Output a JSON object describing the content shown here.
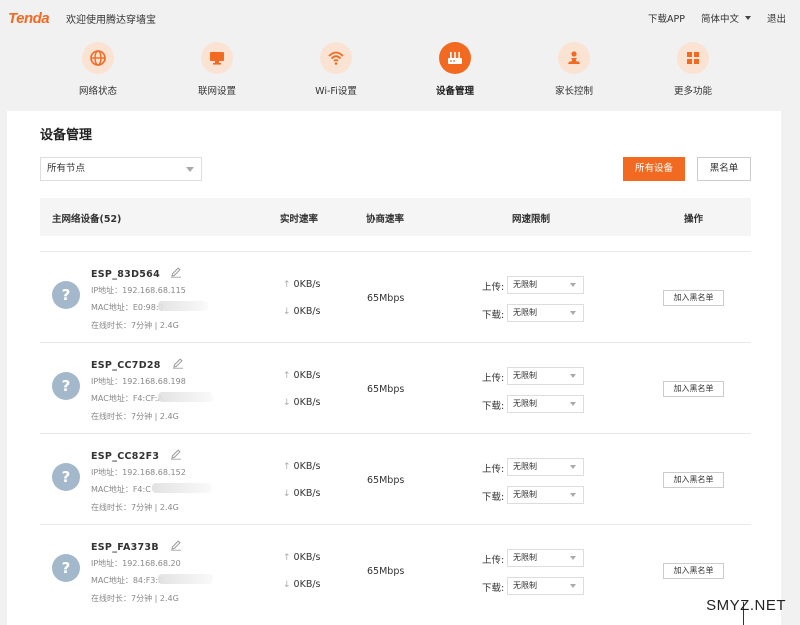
{
  "header": {
    "logo": "Tenda",
    "welcome": "欢迎使用腾达穿墙宝",
    "download_app": "下载APP",
    "language": "简体中文",
    "logout": "退出"
  },
  "nav": [
    {
      "label": "网络状态",
      "icon": "globe-icon"
    },
    {
      "label": "联网设置",
      "icon": "monitor-icon"
    },
    {
      "label": "Wi-Fi设置",
      "icon": "wifi-icon"
    },
    {
      "label": "设备管理",
      "icon": "router-icon",
      "active": true
    },
    {
      "label": "家长控制",
      "icon": "parental-icon"
    },
    {
      "label": "更多功能",
      "icon": "grid-icon"
    }
  ],
  "page": {
    "title": "设备管理",
    "node_select": "所有节点",
    "btn_all": "所有设备",
    "btn_blacklist": "黑名单"
  },
  "table": {
    "headers": [
      "主网络设备(52)",
      "实时速率",
      "协商速率",
      "网速限制",
      "操作"
    ],
    "upload_label": "上传:",
    "download_label": "下载:",
    "limit_value": "无限制",
    "op_label": "加入黑名单"
  },
  "devices": [
    {
      "name": "ESP_83D564",
      "ip": "IP地址：192.168.68.115",
      "mac": "MAC地址：E0:98:0",
      "online": "在线时长：7分钟 | 2.4G",
      "up": "0KB/s",
      "down": "0KB/s",
      "nego": "65Mbps"
    },
    {
      "name": "ESP_CC7D28",
      "ip": "IP地址：192.168.68.198",
      "mac": "MAC地址：F4:CF:A",
      "online": "在线时长：7分钟 | 2.4G",
      "up": "0KB/s",
      "down": "0KB/s",
      "nego": "65Mbps"
    },
    {
      "name": "ESP_CC82F3",
      "ip": "IP地址：192.168.68.152",
      "mac": "MAC地址：F4:C",
      "online": "在线时长：7分钟 | 2.4G",
      "up": "0KB/s",
      "down": "0KB/s",
      "nego": "65Mbps"
    },
    {
      "name": "ESP_FA373B",
      "ip": "IP地址：192.168.68.20",
      "mac": "MAC地址：84:F3:E",
      "online": "在线时长：7分钟 | 2.4G",
      "up": "0KB/s",
      "down": "0KB/s",
      "nego": "65Mbps"
    }
  ],
  "watermark": "SMYZ.NET"
}
